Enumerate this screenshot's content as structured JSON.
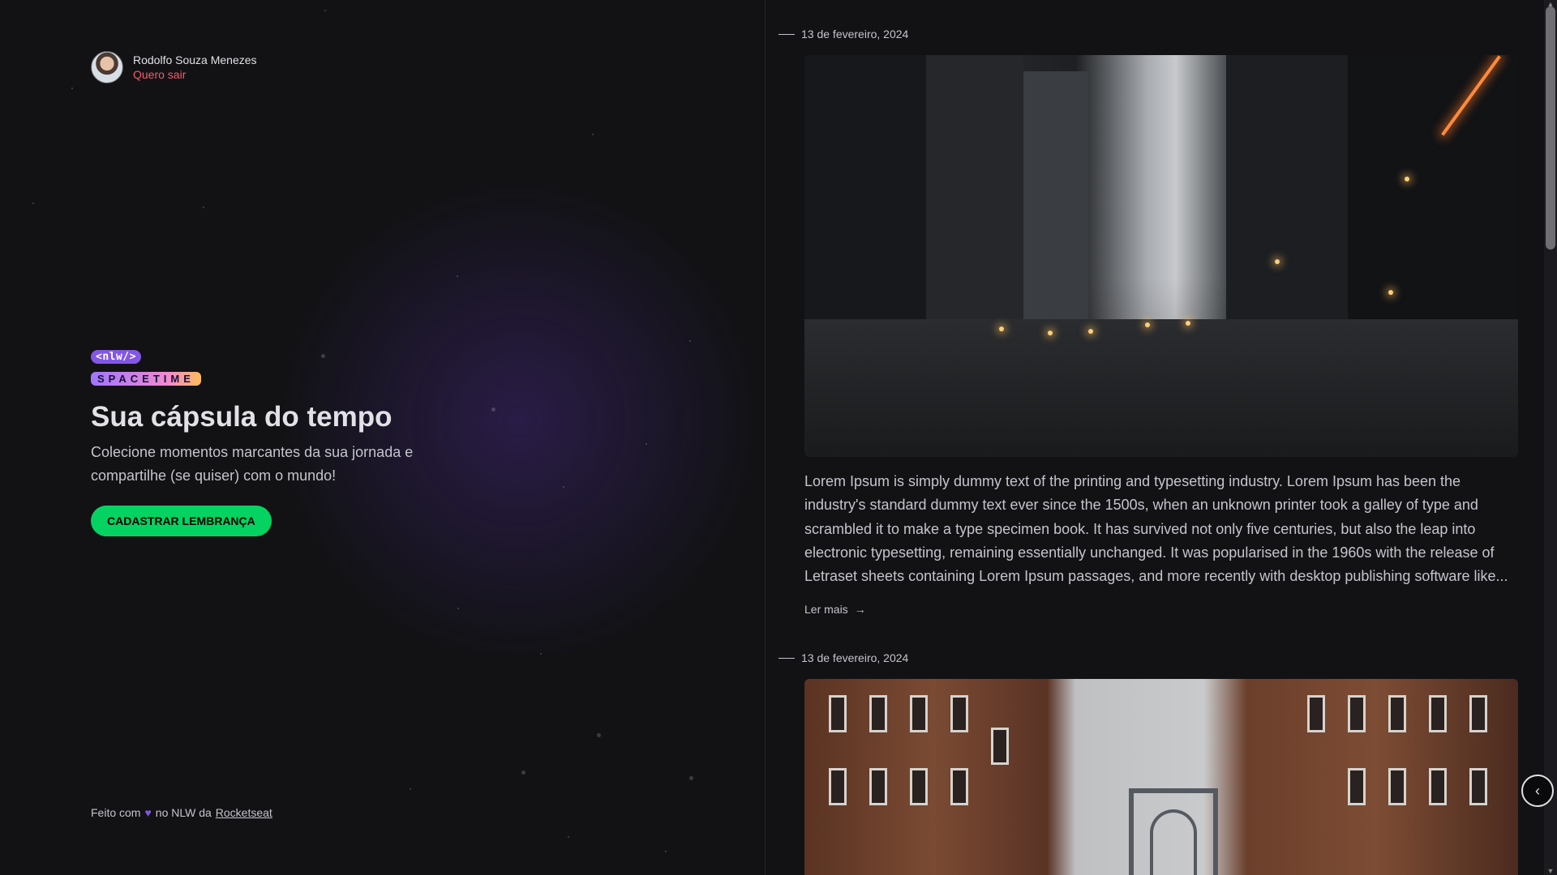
{
  "user": {
    "name": "Rodolfo Souza Menezes",
    "logout_label": "Quero sair"
  },
  "hero": {
    "logo_top": "<nlw/>",
    "logo_bottom": "SPACETIME",
    "title": "Sua cápsula do tempo",
    "subtitle": "Colecione momentos marcantes da sua jornada e compartilhe (se quiser) com o mundo!",
    "cta_label": "CADASTRAR LEMBRANÇA"
  },
  "footer": {
    "prefix": "Feito com",
    "middle": "no NLW da",
    "link": "Rocketseat"
  },
  "memories": [
    {
      "date": "13 de fevereiro, 2024",
      "text": "Lorem Ipsum is simply dummy text of the printing and typesetting industry. Lorem Ipsum has been the industry's standard dummy text ever since the 1500s, when an unknown printer took a galley of type and scrambled it to make a type specimen book. It has survived not only five centuries, but also the leap into electronic typesetting, remaining essentially unchanged. It was popularised in the 1960s with the release of Letraset sheets containing Lorem Ipsum passages, and more recently with desktop publishing software like...",
      "more_label": "Ler mais"
    },
    {
      "date": "13 de fevereiro, 2024"
    }
  ],
  "colors": {
    "accent_green": "#04d361",
    "accent_purple": "#8257e5",
    "logout_red": "#f75a68",
    "background": "#121215"
  },
  "icons": {
    "heart": "heart-icon",
    "arrow": "arrow-right-icon",
    "floating": "chevron-left-icon"
  }
}
